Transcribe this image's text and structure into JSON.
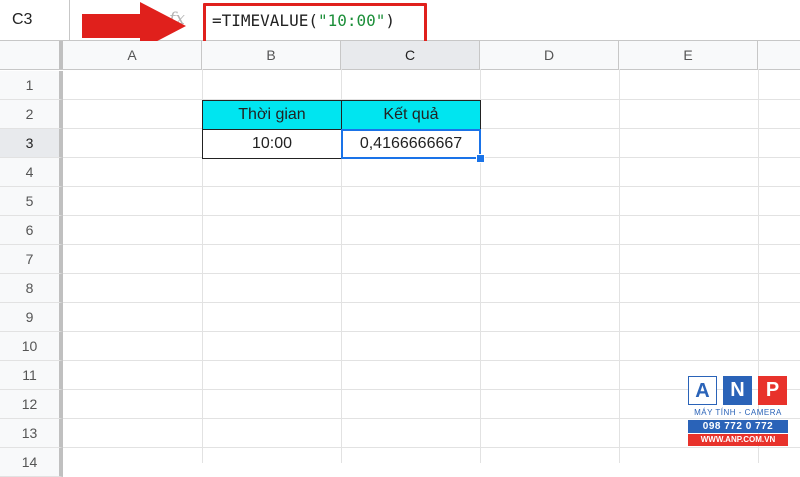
{
  "formula_bar": {
    "name_box": "C3",
    "fx_label": "fx",
    "formula_prefix": "=TIMEVALUE(",
    "formula_string": "\"10:00\"",
    "formula_suffix": ")"
  },
  "columns": [
    "A",
    "B",
    "C",
    "D",
    "E"
  ],
  "selected_column": "C",
  "rows": [
    "1",
    "2",
    "3",
    "4",
    "5",
    "6",
    "7",
    "8",
    "9",
    "10",
    "11",
    "12",
    "13",
    "14"
  ],
  "selected_row": "3",
  "table": {
    "header_time": "Thời gian",
    "header_result": "Kết quả",
    "time_value": "10:00",
    "result_value": "0,4166666667"
  },
  "colors": {
    "header_fill": "#00e5f0",
    "selection": "#1a73e8",
    "annotation_red": "#e0201c"
  },
  "logo": {
    "letter_a": "A",
    "letter_n": "N",
    "letter_p": "P",
    "subtitle": "MÁY TÍNH - CAMERA",
    "phone": "098 772 0 772",
    "website": "WWW.ANP.COM.VN"
  }
}
